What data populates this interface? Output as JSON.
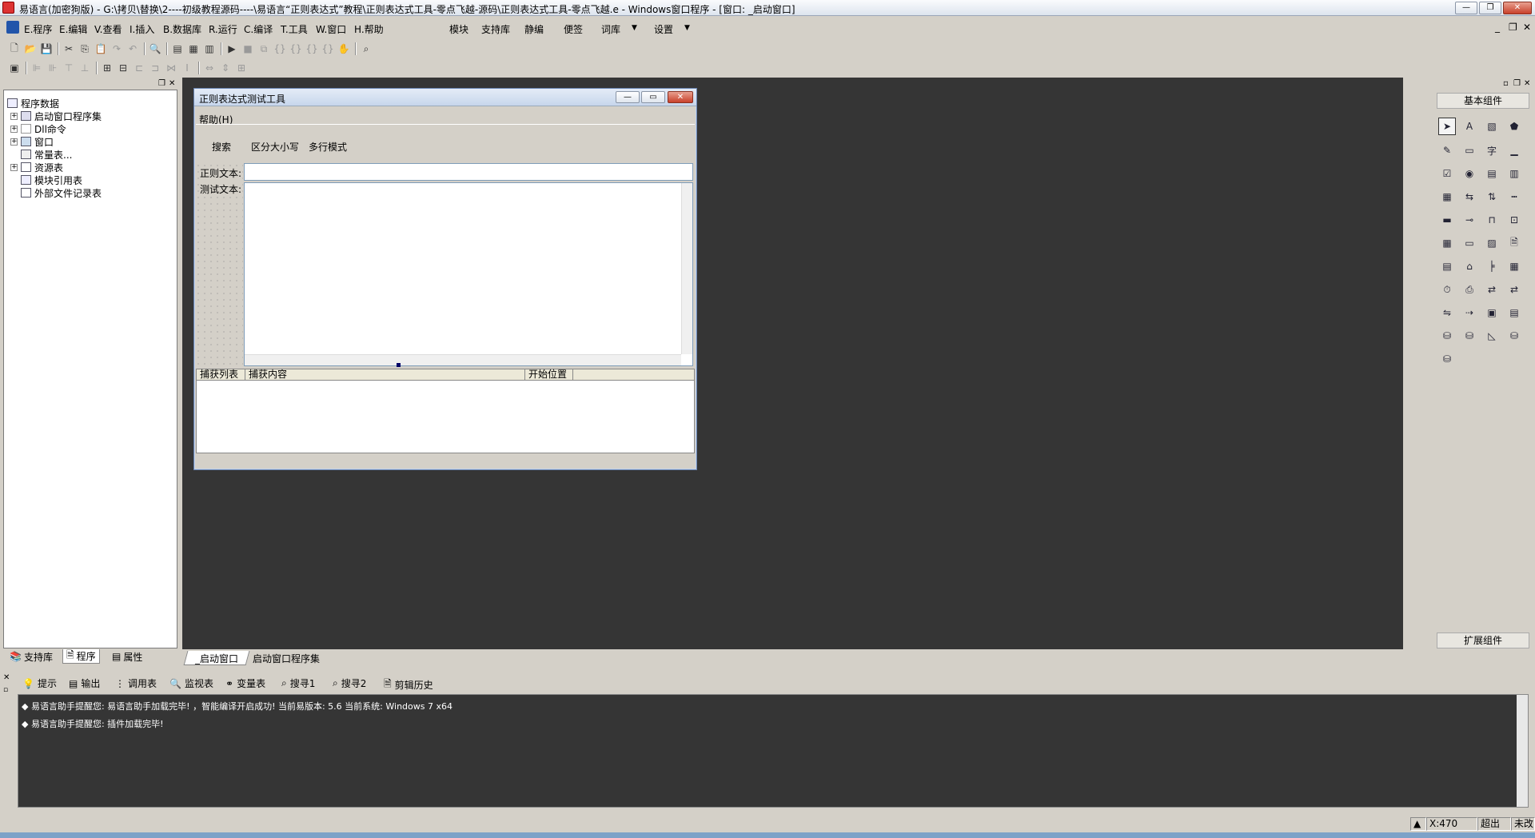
{
  "window": {
    "title": "易语言(加密狗版) - G:\\拷贝\\替换\\2----初级教程源码----\\易语言“正则表达式”教程\\正则表达式工具-零点飞越-源码\\正则表达式工具-零点飞越.e - Windows窗口程序 - [窗口: _启动窗口]"
  },
  "menu": {
    "items": [
      "E.程序",
      "E.编辑",
      "V.查看",
      "I.插入",
      "B.数据库",
      "R.运行",
      "C.编译",
      "T.工具",
      "W.窗口",
      "H.帮助"
    ],
    "extra": [
      "模块",
      "支持库",
      "静编",
      "便签",
      "词库",
      "设置"
    ]
  },
  "left_panel": {
    "tree": [
      {
        "label": "程序数据",
        "level": 0
      },
      {
        "label": "启动窗口程序集",
        "level": 1
      },
      {
        "label": "Dll命令",
        "level": 1
      },
      {
        "label": "窗口",
        "level": 1
      },
      {
        "label": "常量表...",
        "level": 1
      },
      {
        "label": "资源表",
        "level": 1
      },
      {
        "label": "模块引用表",
        "level": 1
      },
      {
        "label": "外部文件记录表",
        "level": 1
      }
    ],
    "tabs": [
      "支持库",
      "程序",
      "属性"
    ]
  },
  "designer": {
    "title": "正则表达式测试工具",
    "menu": "帮助(H)",
    "buttons": [
      "搜索",
      "区分大小写",
      "多行模式"
    ],
    "labels": {
      "regex": "正则文本:",
      "test": "测试文本:"
    },
    "list_headers": [
      "捕获列表",
      "捕获内容",
      "开始位置"
    ]
  },
  "editor_tabs": [
    "_启动窗口",
    "启动窗口程序集"
  ],
  "right_panel": {
    "top_label": "基本组件",
    "bottom_label": "扩展组件"
  },
  "output_tabs": [
    "提示",
    "输出",
    "调用表",
    "监视表",
    "变量表",
    "搜寻1",
    "搜寻2",
    "剪辑历史"
  ],
  "output_lines": [
    "易语言助手提醒您: 易语言助手加载完毕! ，智能编译开启成功! 当前易版本: 5.6  当前系统: Windows 7 x64",
    "易语言助手提醒您: 插件加载完毕!"
  ],
  "status": {
    "coord": "X:470",
    "overwrite": "超出",
    "modified": "未改"
  }
}
